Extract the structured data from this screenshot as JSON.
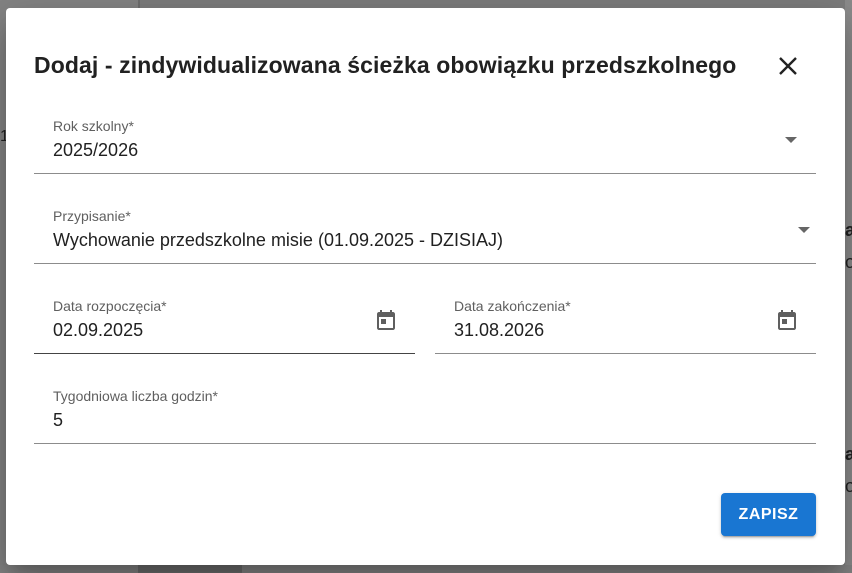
{
  "dialog": {
    "title": "Dodaj - zindywidualizowana ścieżka obowiązku przedszkolnego",
    "close_icon": "close-icon",
    "save_label": "ZAPISZ"
  },
  "fields": {
    "school_year": {
      "label": "Rok szkolny*",
      "value": "2025/2026"
    },
    "assignment": {
      "label": "Przypisanie*",
      "value": "Wychowanie przedszkolne misie (01.09.2025 - DZISIAJ)"
    },
    "start_date": {
      "label": "Data rozpoczęcia*",
      "value": "02.09.2025"
    },
    "end_date": {
      "label": "Data zakończenia*",
      "value": "31.08.2026"
    },
    "weekly_hours": {
      "label": "Tygodniowa liczba godzin*",
      "value": "5"
    }
  },
  "background": {
    "glyph_1": "1",
    "glyph_2": "a",
    "glyph_3": "o",
    "glyph_4": "a",
    "glyph_5": "o"
  },
  "colors": {
    "accent": "#1976d2",
    "backdrop": "#7d7d7d"
  }
}
